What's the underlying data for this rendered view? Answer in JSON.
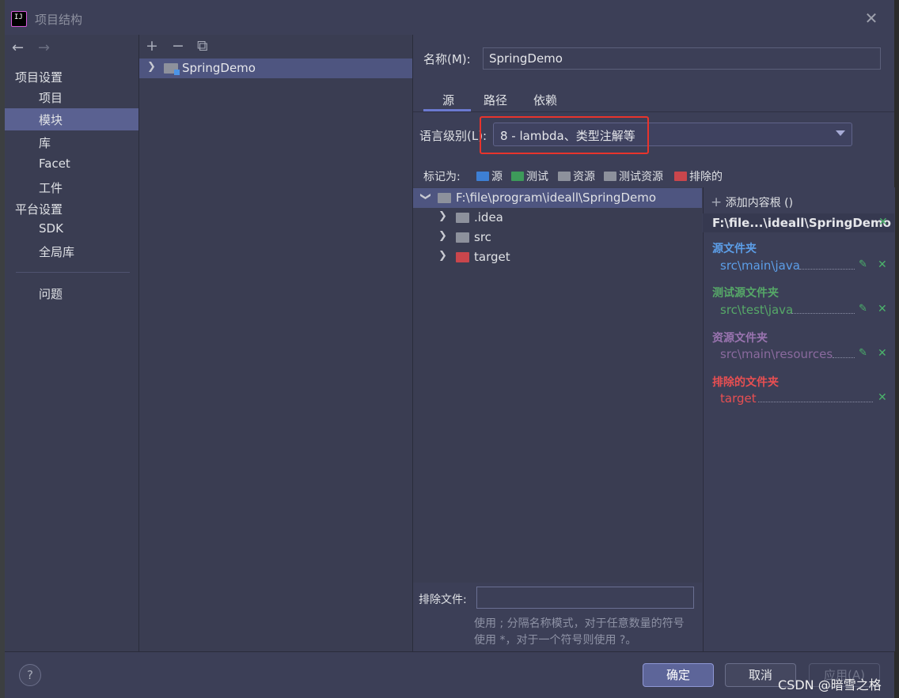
{
  "window": {
    "title": "项目结构"
  },
  "nav": {
    "section_project": "项目设置",
    "items_project": [
      "项目",
      "模块",
      "库",
      "Facet",
      "工件"
    ],
    "section_platform": "平台设置",
    "items_platform": [
      "SDK",
      "全局库"
    ],
    "problems": "问题",
    "selected": "模块"
  },
  "modules": {
    "toolbar": [
      "+",
      "−",
      "⧉"
    ],
    "list": [
      "SpringDemo"
    ]
  },
  "module": {
    "name_label": "名称(M):",
    "name_value": "SpringDemo",
    "tabs": [
      "源",
      "路径",
      "依赖"
    ],
    "language_label": "语言级别(L):",
    "language_value": "8 - lambda、类型注解等",
    "mark_as_label": "标记为:",
    "mark_as": [
      {
        "label": "源",
        "color": "#3d7fd4"
      },
      {
        "label": "测试",
        "color": "#3d9a5a"
      },
      {
        "label": "资源",
        "color": "#8d919c"
      },
      {
        "label": "测试资源",
        "color": "#8d919c"
      },
      {
        "label": "排除的",
        "color": "#c9464c"
      }
    ]
  },
  "tree": {
    "root": "F:\\file\\program\\ideall\\SpringDemo",
    "children": [
      {
        "label": ".idea",
        "color": "#8d919c"
      },
      {
        "label": "src",
        "color": "#8d919c"
      },
      {
        "label": "target",
        "color": "#c9464c"
      }
    ]
  },
  "roots": {
    "add_label": "添加内容根 ()",
    "path": "F:\\file...\\ideall\\SpringDemo",
    "sections": [
      {
        "title": "源文件夹",
        "path": "src\\main\\java",
        "color": "#5c9ee8",
        "path_color": "#5c9ee8"
      },
      {
        "title": "测试源文件夹",
        "path": "src\\test\\java",
        "color": "#56a868",
        "path_color": "#56a868"
      },
      {
        "title": "资源文件夹",
        "path": "src\\main\\resources",
        "color": "#9a74b0",
        "path_color": "#8a6a9e"
      },
      {
        "title": "排除的文件夹",
        "path": "target",
        "color": "#e84f52",
        "path_color": "#e84f52"
      }
    ]
  },
  "exclude": {
    "label": "排除文件:",
    "hint_line1": "使用 ; 分隔名称模式，对于任意数量的符号",
    "hint_line2": "使用 *，对于一个符号则使用 ?。"
  },
  "footer": {
    "help": "?",
    "ok": "确定",
    "cancel": "取消",
    "apply": "应用(A)"
  },
  "watermark": "CSDN @暗雪之格"
}
